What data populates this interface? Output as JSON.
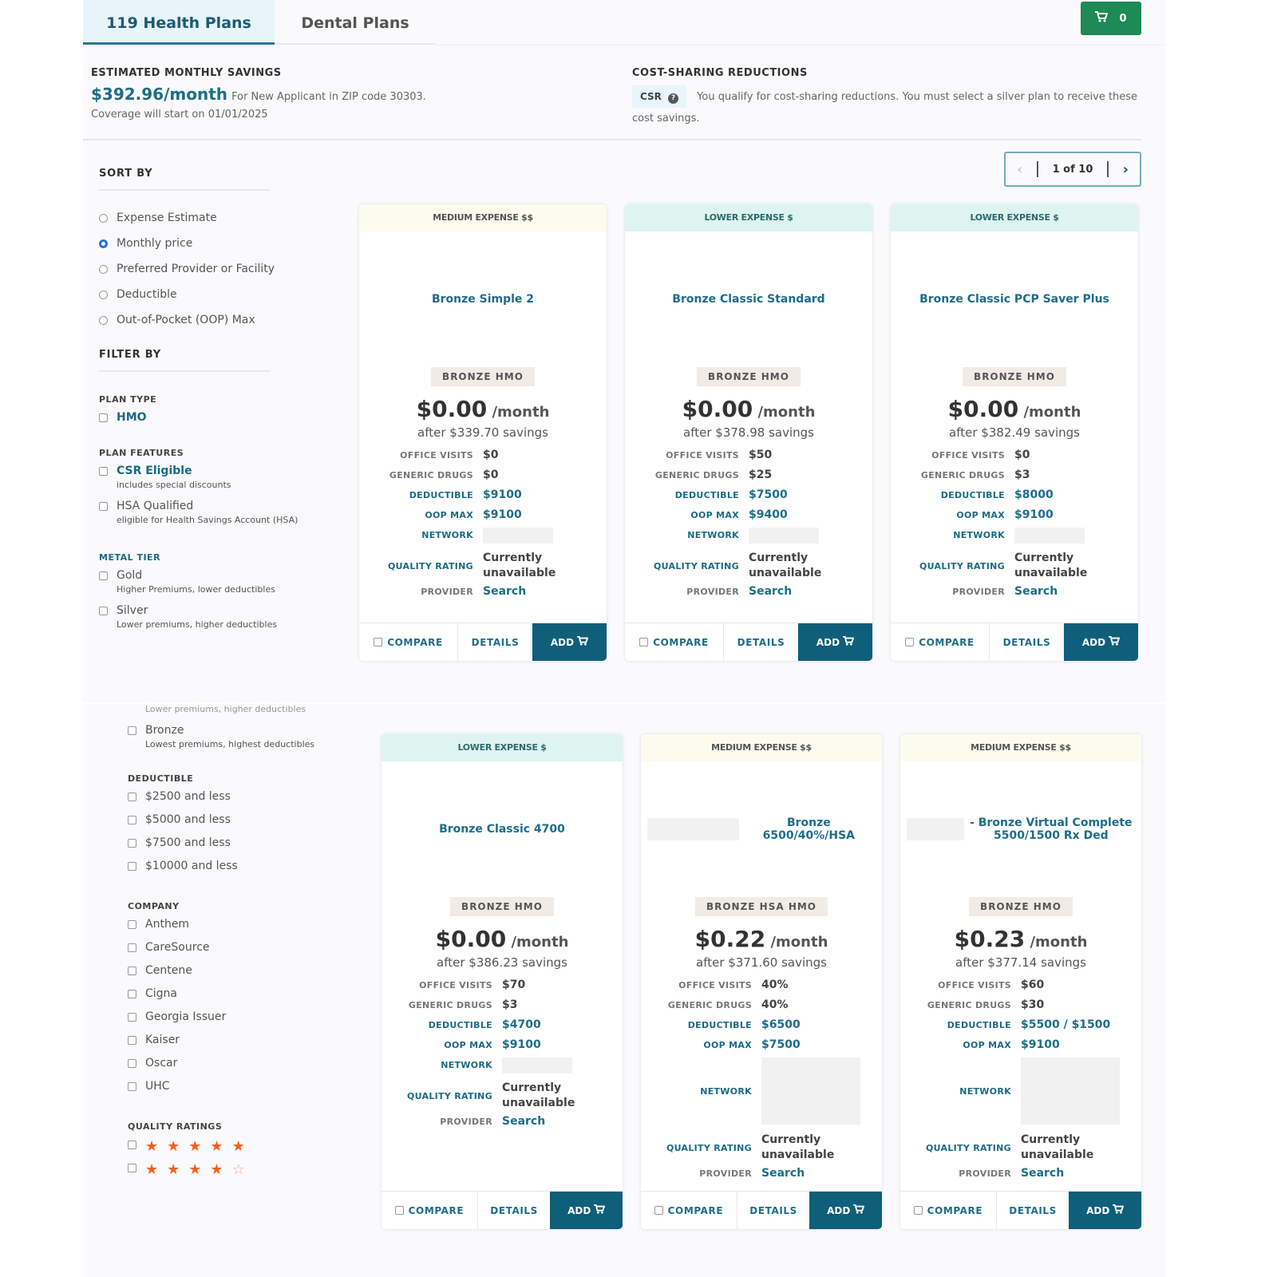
{
  "tabs": [
    {
      "label": "119 Health Plans",
      "active": true
    },
    {
      "label": "Dental Plans",
      "active": false
    }
  ],
  "cart": {
    "icon": "cart-icon",
    "count": "0"
  },
  "savings": {
    "title": "ESTIMATED MONTHLY SAVINGS",
    "amount": "$392.96/month",
    "for_text": "For  New Applicant in ZIP code 30303.",
    "coverage": "Coverage will start on 01/01/2025"
  },
  "csr": {
    "title": "COST-SHARING REDUCTIONS",
    "badge": "CSR",
    "badge_icon": "question-circle-icon",
    "text": "You qualify for cost-sharing reductions. You must select a silver plan to receive these cost savings."
  },
  "pager": {
    "text": "1 of 10",
    "prev_icon": "chevron-left-icon",
    "next_icon": "chevron-right-icon"
  },
  "sidebar": {
    "sort_title": "SORT BY",
    "sort_options": [
      {
        "label": "Expense Estimate",
        "selected": false
      },
      {
        "label": "Monthly price",
        "selected": true
      },
      {
        "label": "Preferred Provider or Facility",
        "selected": false
      },
      {
        "label": "Deductible",
        "selected": false
      },
      {
        "label": "Out-of-Pocket (OOP) Max",
        "selected": false
      }
    ],
    "filter_title": "FILTER BY",
    "plan_type": {
      "label": "PLAN TYPE",
      "options": [
        {
          "label": "HMO"
        }
      ]
    },
    "plan_features": {
      "label": "PLAN FEATURES",
      "options": [
        {
          "label": "CSR Eligible",
          "sub": "includes special discounts"
        },
        {
          "label": "HSA Qualified",
          "sub": "eligible for Health Savings Account (HSA)"
        }
      ]
    },
    "metal_tier": {
      "label": "METAL TIER",
      "options": [
        {
          "label": "Gold",
          "sub": "Higher Premiums, lower deductibles"
        },
        {
          "label": "Silver",
          "sub": "Lower premiums, higher deductibles"
        },
        {
          "label": "Bronze",
          "sub": "Lowest premiums, highest deductibles"
        }
      ]
    },
    "deductible": {
      "label": "DEDUCTIBLE",
      "options": [
        "$2500 and less",
        "$5000 and less",
        "$7500 and less",
        "$10000 and less"
      ]
    },
    "company": {
      "label": "COMPANY",
      "options": [
        "Anthem",
        "CareSource",
        "Centene",
        "Cigna",
        "Georgia Issuer",
        "Kaiser",
        "Oscar",
        "UHC"
      ]
    },
    "quality": {
      "label": "QUALITY RATINGS",
      "options": [
        {
          "stars": 5,
          "of": 5
        },
        {
          "stars": 4,
          "of": 5
        }
      ]
    }
  },
  "card_labels": {
    "office": "OFFICE VISITS",
    "drugs": "GENERIC DRUGS",
    "deductible": "DEDUCTIBLE",
    "oop": "OOP MAX",
    "network": "NETWORK",
    "quality": "QUALITY RATING",
    "provider": "PROVIDER",
    "per_month": "/month",
    "compare": "COMPARE",
    "details": "DETAILS",
    "add": "ADD"
  },
  "plans": [
    {
      "band": "MEDIUM EXPENSE $$",
      "band_type": "medium",
      "name": "Bronze Simple 2",
      "tags": "BRONZE  HMO",
      "price": "$0.00",
      "after": "after $339.70 savings",
      "office": "$0",
      "drugs": "$0",
      "deductible": "$9100",
      "oop": "$9100",
      "quality": "Currently unavailable",
      "provider": "Search"
    },
    {
      "band": "LOWER EXPENSE $",
      "band_type": "lower",
      "name": "Bronze Classic Standard",
      "tags": "BRONZE  HMO",
      "price": "$0.00",
      "after": "after $378.98 savings",
      "office": "$50",
      "drugs": "$25",
      "deductible": "$7500",
      "oop": "$9400",
      "quality": "Currently unavailable",
      "provider": "Search"
    },
    {
      "band": "LOWER EXPENSE $",
      "band_type": "lower",
      "name": "Bronze Classic PCP Saver Plus",
      "tags": "BRONZE  HMO",
      "price": "$0.00",
      "after": "after $382.49 savings",
      "office": "$0",
      "drugs": "$3",
      "deductible": "$8000",
      "oop": "$9100",
      "quality": "Currently unavailable",
      "provider": "Search"
    },
    {
      "band": "LOWER EXPENSE $",
      "band_type": "lower",
      "name": "Bronze Classic 4700",
      "tags": "BRONZE  HMO",
      "price": "$0.00",
      "after": "after $386.23 savings",
      "office": "$70",
      "drugs": "$3",
      "deductible": "$4700",
      "oop": "$9100",
      "quality": "Currently unavailable",
      "provider": "Search"
    },
    {
      "band": "MEDIUM EXPENSE $$",
      "band_type": "medium",
      "name": "Bronze 6500/40%/HSA",
      "tags": "BRONZE  HSA  HMO",
      "price": "$0.22",
      "after": "after $371.60 savings",
      "office": "40%",
      "drugs": "40%",
      "deductible": "$6500",
      "oop": "$7500",
      "quality": "Currently unavailable",
      "provider": "Search"
    },
    {
      "band": "MEDIUM EXPENSE $$",
      "band_type": "medium",
      "name": "- Bronze Virtual Complete 5500/1500 Rx Ded",
      "tags": "BRONZE  HMO",
      "price": "$0.23",
      "after": "after $377.14 savings",
      "office": "$60",
      "drugs": "$30",
      "deductible": "$5500 / $1500",
      "oop": "$9100",
      "quality": "Currently unavailable",
      "provider": "Search"
    }
  ],
  "colors": {
    "teal": "#1b6a86",
    "add_button": "#0f5e7a",
    "cart_button": "#1e8a55",
    "star": "#f2601a"
  }
}
